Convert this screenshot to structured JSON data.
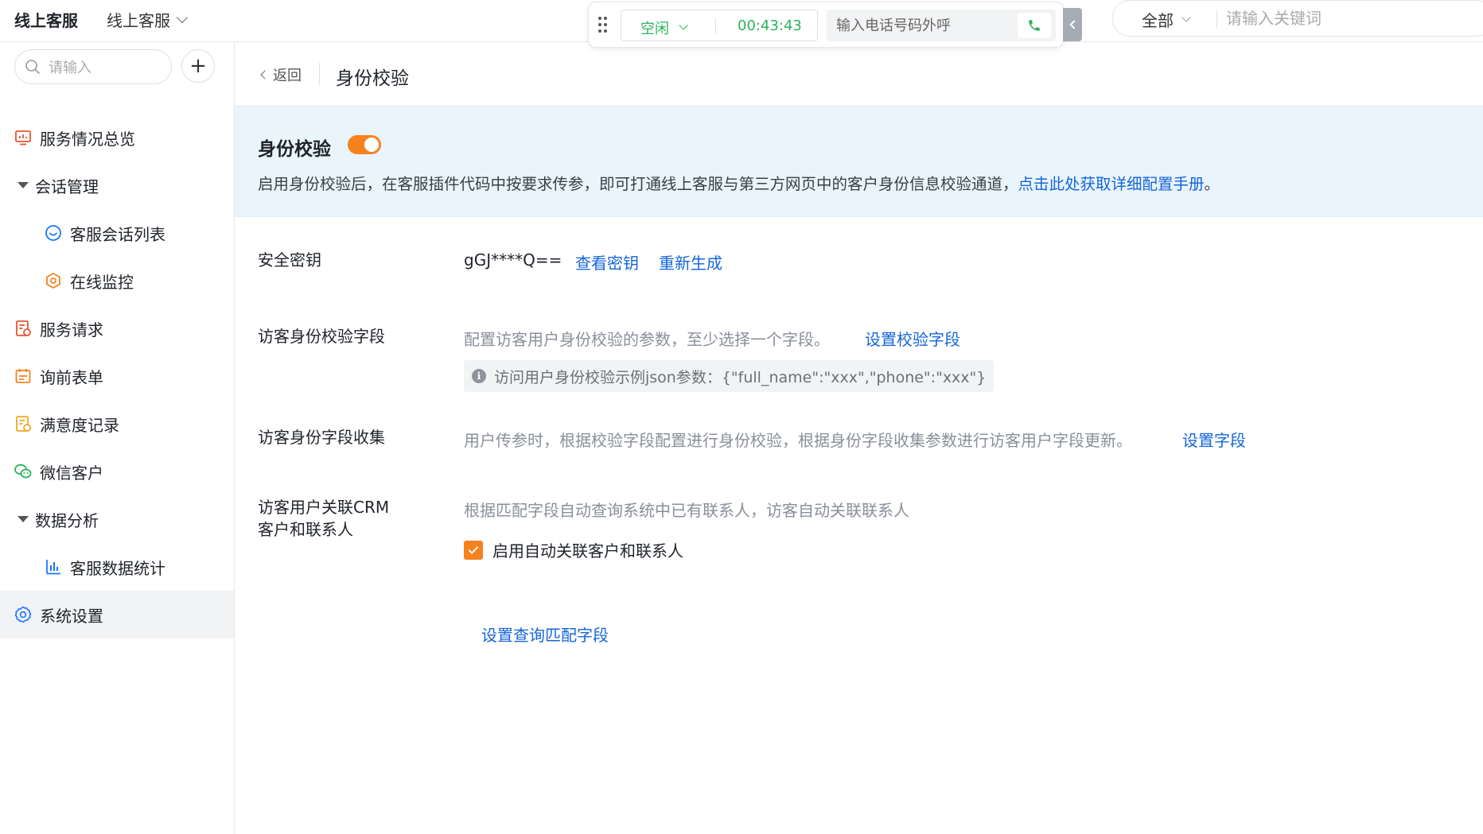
{
  "topbar": {
    "brand": "线上客服",
    "app_switch": "线上客服",
    "status": "空闲",
    "timer": "00:43:43",
    "dial_placeholder": "输入电话号码外呼",
    "search_scope": "全部",
    "search_placeholder": "请输入关键词"
  },
  "sidebar": {
    "search_placeholder": "请输入",
    "add_label": "+",
    "items": [
      {
        "label": "服务情况总览",
        "icon": "monitor-chart-icon"
      },
      {
        "label": "会话管理",
        "icon": "caret-down-icon"
      },
      {
        "label": "客服会话列表",
        "icon": "chat-bubble-icon"
      },
      {
        "label": "在线监控",
        "icon": "hexagon-monitor-icon"
      },
      {
        "label": "服务请求",
        "icon": "request-doc-icon"
      },
      {
        "label": "询前表单",
        "icon": "form-icon"
      },
      {
        "label": "满意度记录",
        "icon": "satisfaction-doc-icon"
      },
      {
        "label": "微信客户",
        "icon": "wechat-icon"
      },
      {
        "label": "数据分析",
        "icon": "caret-down-icon"
      },
      {
        "label": "客服数据统计",
        "icon": "bar-chart-icon"
      },
      {
        "label": "系统设置",
        "icon": "gear-icon"
      }
    ]
  },
  "breadcrumb": {
    "back": "返回",
    "title": "身份校验"
  },
  "banner": {
    "title": "身份校验",
    "toggle_on": true,
    "desc": "启用身份校验后，在客服插件代码中按要求传参，即可打通线上客服与第三方网页中的客户身份信息校验通道，",
    "link": "点击此处获取详细配置手册",
    "tail": "。"
  },
  "security_key": {
    "label": "安全密钥",
    "value": "gGJ****Q==",
    "view": "查看密钥",
    "regen": "重新生成"
  },
  "verify_fields": {
    "label": "访客身份校验字段",
    "desc": "配置访客用户身份校验的参数，至少选择一个字段。",
    "link": "设置校验字段",
    "tip": "访问用户身份校验示例json参数：{\"full_name\":\"xxx\",\"phone\":\"xxx\"}"
  },
  "collect_fields": {
    "label": "访客身份字段收集",
    "desc": "用户传参时，根据校验字段配置进行身份校验，根据身份字段收集参数进行访客用户字段更新。",
    "link": "设置字段"
  },
  "crm_link": {
    "label_line1": "访客用户关联CRM",
    "label_line2": "客户和联系人",
    "desc": "根据匹配字段自动查询系统中已有联系人，访客自动关联联系人",
    "checkbox_label": "启用自动关联客户和联系人",
    "checked": true,
    "link": "设置查询匹配字段"
  },
  "colors": {
    "accent_orange": "#f5821f",
    "link_blue": "#1565d8",
    "status_green": "#2db35d",
    "banner_bg": "#e9f4fc"
  }
}
